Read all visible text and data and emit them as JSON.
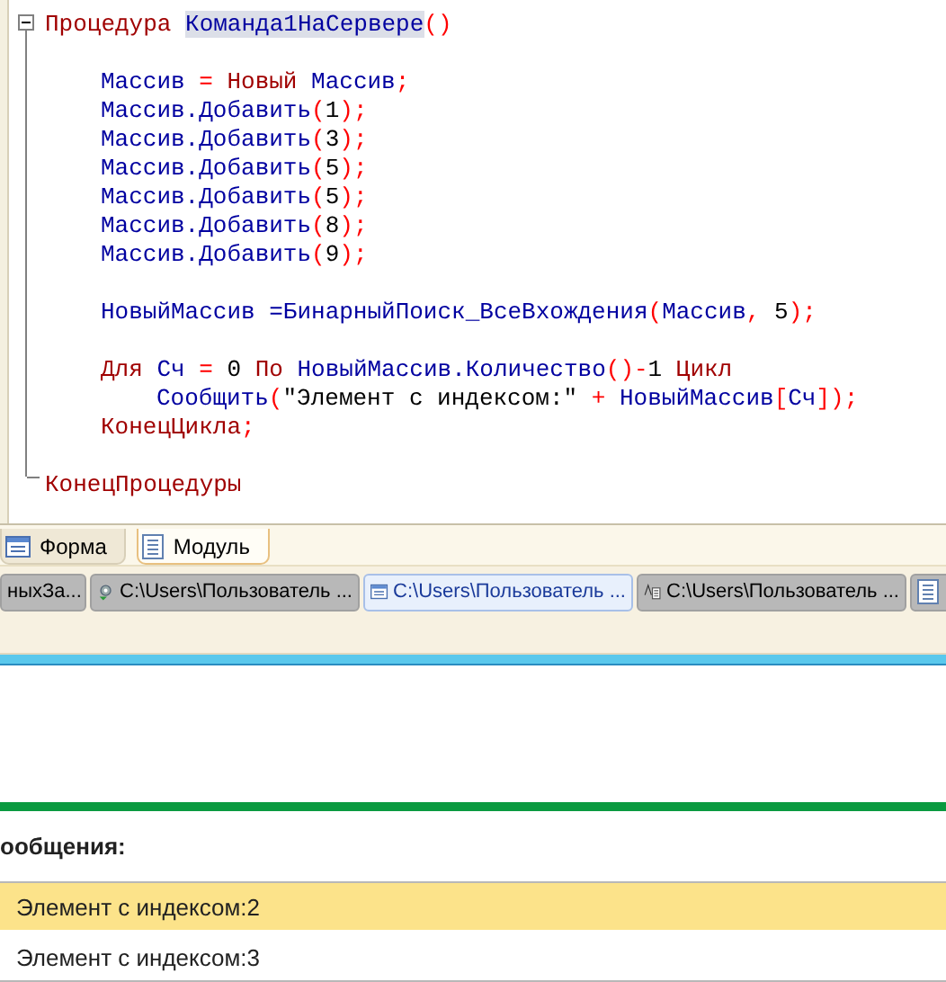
{
  "editor": {
    "header": {
      "keyword": "Процедура",
      "name": "Команда1НаСервере",
      "name_selected": true,
      "parens": "()"
    },
    "expanded": true,
    "lines": [
      {
        "kind": "blank"
      },
      {
        "kind": "code",
        "tokens": [
          {
            "kind": "identifier",
            "text": "Массив"
          },
          {
            "kind": "operator",
            "text": " = "
          },
          {
            "kind": "keyword",
            "text": "Новый"
          },
          {
            "kind": "identifier",
            "text": " Массив"
          },
          {
            "kind": "operator",
            "text": ";"
          }
        ]
      },
      {
        "kind": "code",
        "tokens": [
          {
            "kind": "identifier",
            "text": "Массив.Добавить"
          },
          {
            "kind": "operator",
            "text": "("
          },
          {
            "kind": "literal",
            "text": "1"
          },
          {
            "kind": "operator",
            "text": ");"
          }
        ]
      },
      {
        "kind": "code",
        "tokens": [
          {
            "kind": "identifier",
            "text": "Массив.Добавить"
          },
          {
            "kind": "operator",
            "text": "("
          },
          {
            "kind": "literal",
            "text": "3"
          },
          {
            "kind": "operator",
            "text": ");"
          }
        ]
      },
      {
        "kind": "code",
        "tokens": [
          {
            "kind": "identifier",
            "text": "Массив.Добавить"
          },
          {
            "kind": "operator",
            "text": "("
          },
          {
            "kind": "literal",
            "text": "5"
          },
          {
            "kind": "operator",
            "text": ");"
          }
        ]
      },
      {
        "kind": "code",
        "tokens": [
          {
            "kind": "identifier",
            "text": "Массив.Добавить"
          },
          {
            "kind": "operator",
            "text": "("
          },
          {
            "kind": "literal",
            "text": "5"
          },
          {
            "kind": "operator",
            "text": ");"
          }
        ]
      },
      {
        "kind": "code",
        "tokens": [
          {
            "kind": "identifier",
            "text": "Массив.Добавить"
          },
          {
            "kind": "operator",
            "text": "("
          },
          {
            "kind": "literal",
            "text": "8"
          },
          {
            "kind": "operator",
            "text": ");"
          }
        ]
      },
      {
        "kind": "code",
        "tokens": [
          {
            "kind": "identifier",
            "text": "Массив.Добавить"
          },
          {
            "kind": "operator",
            "text": "("
          },
          {
            "kind": "literal",
            "text": "9"
          },
          {
            "kind": "operator",
            "text": ");"
          }
        ]
      },
      {
        "kind": "blank"
      },
      {
        "kind": "code",
        "tokens": [
          {
            "kind": "identifier",
            "text": "НовыйМассив ="
          },
          {
            "kind": "identifier",
            "text": "БинарныйПоиск_ВсеВхождения"
          },
          {
            "kind": "operator",
            "text": "("
          },
          {
            "kind": "identifier",
            "text": "Массив"
          },
          {
            "kind": "operator",
            "text": ","
          },
          {
            "kind": "literal",
            "text": " 5"
          },
          {
            "kind": "operator",
            "text": ");"
          }
        ]
      },
      {
        "kind": "blank"
      },
      {
        "kind": "code",
        "tokens": [
          {
            "kind": "keyword",
            "text": "Для"
          },
          {
            "kind": "identifier",
            "text": " Сч "
          },
          {
            "kind": "operator",
            "text": "="
          },
          {
            "kind": "literal",
            "text": " 0 "
          },
          {
            "kind": "keyword",
            "text": "По"
          },
          {
            "kind": "identifier",
            "text": " НовыйМассив.Количество"
          },
          {
            "kind": "operator",
            "text": "()-"
          },
          {
            "kind": "literal",
            "text": "1 "
          },
          {
            "kind": "keyword",
            "text": "Цикл"
          }
        ],
        "children": [
          {
            "kind": "code",
            "tokens": [
              {
                "kind": "identifier",
                "text": "Сообщить"
              },
              {
                "kind": "operator",
                "text": "("
              },
              {
                "kind": "literal",
                "text": "\"Элемент с индексом:\" "
              },
              {
                "kind": "operator",
                "text": "+"
              },
              {
                "kind": "identifier",
                "text": " НовыйМассив"
              },
              {
                "kind": "operator",
                "text": "["
              },
              {
                "kind": "identifier",
                "text": "Сч"
              },
              {
                "kind": "operator",
                "text": "]);"
              }
            ]
          }
        ]
      },
      {
        "kind": "code",
        "tokens": [
          {
            "kind": "keyword",
            "text": "КонецЦикла"
          },
          {
            "kind": "operator",
            "text": ";"
          }
        ]
      },
      {
        "kind": "blank"
      }
    ],
    "footer": "КонецПроцедуры"
  },
  "editor_tabs": [
    {
      "label": "Форма",
      "selected": false,
      "kind": "form"
    },
    {
      "label": "Модуль",
      "selected": true,
      "kind": "module"
    }
  ],
  "window_tabs": [
    {
      "label": "ныхЗа...",
      "selected": false,
      "kind": "plain"
    },
    {
      "label": "C:\\Users\\Пользователь ...",
      "selected": false,
      "kind": "processing"
    },
    {
      "label": "C:\\Users\\Пользователь ...",
      "selected": true,
      "kind": "form"
    },
    {
      "label": "C:\\Users\\Пользователь ...",
      "selected": false,
      "kind": "text"
    },
    {
      "selected": false,
      "kind": "module"
    }
  ],
  "messages": {
    "title": "ообщения:",
    "rows": [
      {
        "text": "Элемент с индексом:2",
        "selected": true
      },
      {
        "text": "Элемент с индексом:3",
        "selected": false
      }
    ]
  }
}
